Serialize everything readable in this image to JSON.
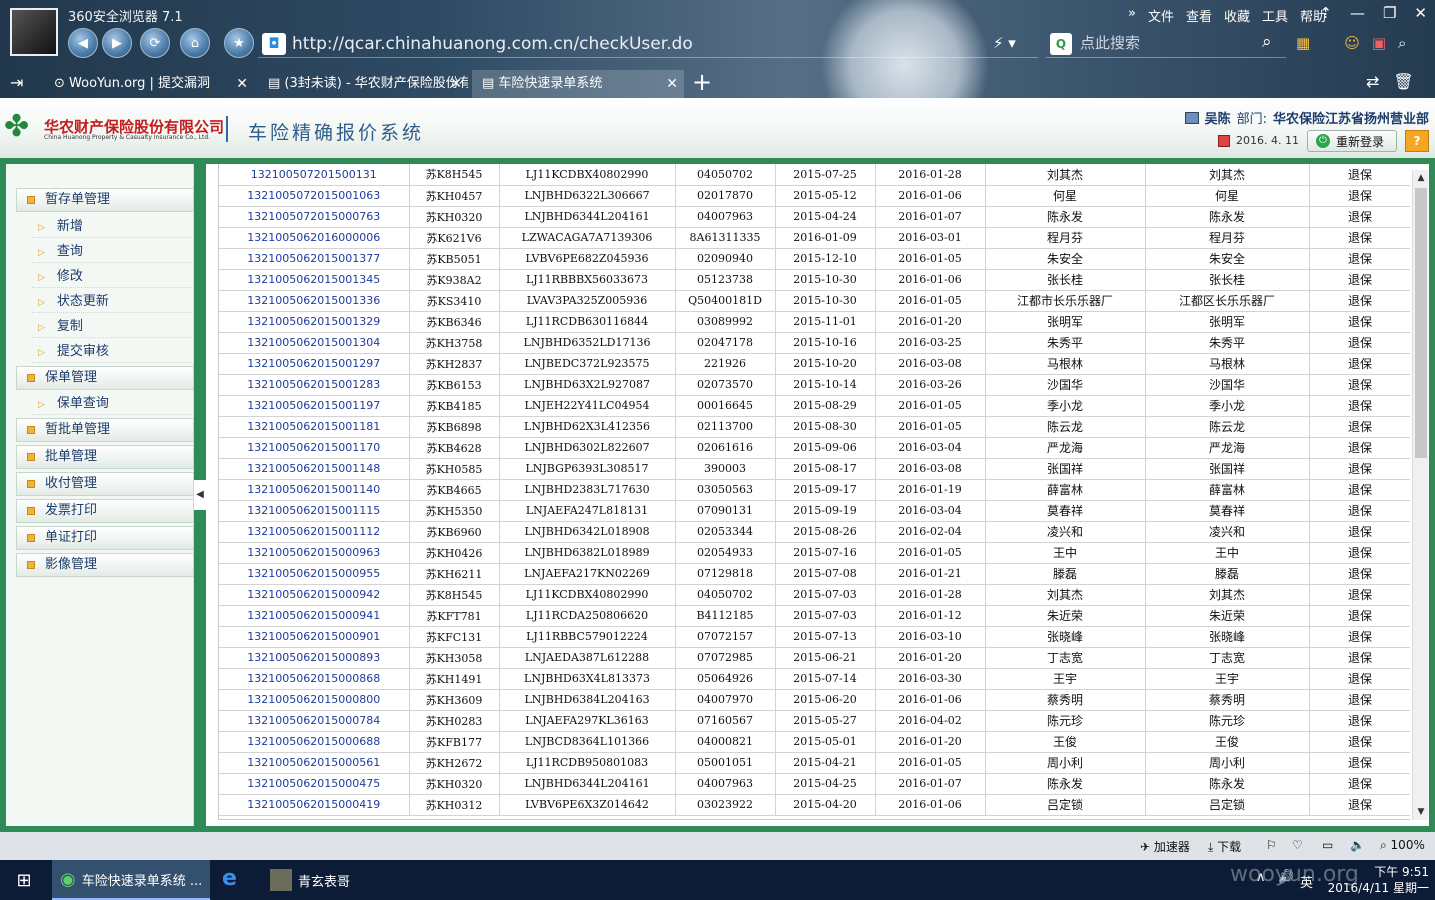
{
  "browser": {
    "title": "360安全浏览器 7.1",
    "url": "http://qcar.chinahuanong.com.cn/checkUser.do",
    "search_placeholder": "点此搜索",
    "menus": [
      "文件",
      "查看",
      "收藏",
      "工具",
      "帮助"
    ],
    "more": "»",
    "tabs": [
      {
        "label": "WooYun.org | 提交漏洞"
      },
      {
        "label": "(3封未读) - 华农财产保险股份有"
      },
      {
        "label": "车险快速录单系统"
      }
    ],
    "new_tab": "+"
  },
  "header": {
    "company_name": "华农财产保险股份有限公司",
    "company_en": "China Huanong Property & Casualty Insurance Co., Ltd.",
    "system_title": "车险精确报价系统",
    "user_name": "吴陈",
    "dept_label": "部门:",
    "dept_value": "华农保险江苏省扬州营业部",
    "date": "2016. 4. 11",
    "relogin": "重新登录",
    "help": "?"
  },
  "sidebar": {
    "groups": [
      {
        "label": "暂存单管理",
        "items": [
          "新增",
          "查询",
          "修改",
          "状态更新",
          "复制",
          "提交审核"
        ]
      },
      {
        "label": "保单管理",
        "items": [
          "保单查询"
        ]
      },
      {
        "label": "暂批单管理",
        "items": []
      },
      {
        "label": "批单管理",
        "items": []
      },
      {
        "label": "收付管理",
        "items": []
      },
      {
        "label": "发票打印",
        "items": []
      },
      {
        "label": "单证打印",
        "items": []
      },
      {
        "label": "影像管理",
        "items": []
      }
    ]
  },
  "table": {
    "rows": [
      [
        "132100507201500131",
        "苏K8H545",
        "LJ11KCDBX40802990",
        "04050702",
        "2015-07-25",
        "2016-01-28",
        "刘其杰",
        "刘其杰",
        "退保"
      ],
      [
        "1321005072015001063",
        "苏KH0457",
        "LNJBHD6322L306667",
        "02017870",
        "2015-05-12",
        "2016-01-06",
        "何星",
        "何星",
        "退保"
      ],
      [
        "1321005072015000763",
        "苏KH0320",
        "LNJBHD6344L204161",
        "04007963",
        "2015-04-24",
        "2016-01-07",
        "陈永发",
        "陈永发",
        "退保"
      ],
      [
        "1321005062016000006",
        "苏K621V6",
        "LZWACAGA7A7139306",
        "8A61311335",
        "2016-01-09",
        "2016-03-01",
        "程月芬",
        "程月芬",
        "退保"
      ],
      [
        "1321005062015001377",
        "苏KB5051",
        "LVBV6PE682Z045936",
        "02090940",
        "2015-12-10",
        "2016-01-05",
        "朱安全",
        "朱安全",
        "退保"
      ],
      [
        "1321005062015001345",
        "苏K938A2",
        "LJ11RBBBX56033673",
        "05123738",
        "2015-10-30",
        "2016-01-06",
        "张长桂",
        "张长桂",
        "退保"
      ],
      [
        "1321005062015001336",
        "苏KS3410",
        "LVAV3PA325Z005936",
        "Q50400181D",
        "2015-10-30",
        "2016-01-05",
        "江都市长乐乐器厂",
        "江都区长乐乐器厂",
        "退保"
      ],
      [
        "1321005062015001329",
        "苏KB6346",
        "LJ11RCDB630116844",
        "03089992",
        "2015-11-01",
        "2016-01-20",
        "张明军",
        "张明军",
        "退保"
      ],
      [
        "1321005062015001304",
        "苏KH3758",
        "LNJBHD6352LD17136",
        "02047178",
        "2015-10-16",
        "2016-03-25",
        "朱秀平",
        "朱秀平",
        "退保"
      ],
      [
        "1321005062015001297",
        "苏KH2837",
        "LNJBEDC372L923575",
        "221926",
        "2015-10-20",
        "2016-03-08",
        "马根林",
        "马根林",
        "退保"
      ],
      [
        "1321005062015001283",
        "苏KB6153",
        "LNJBHD63X2L927087",
        "02073570",
        "2015-10-14",
        "2016-03-26",
        "沙国华",
        "沙国华",
        "退保"
      ],
      [
        "1321005062015001197",
        "苏KB4185",
        "LNJEH22Y41LC04954",
        "00016645",
        "2015-08-29",
        "2016-01-05",
        "季小龙",
        "季小龙",
        "退保"
      ],
      [
        "1321005062015001181",
        "苏KB6898",
        "LNJBHD62X3L412356",
        "02113700",
        "2015-08-30",
        "2016-01-05",
        "陈云龙",
        "陈云龙",
        "退保"
      ],
      [
        "1321005062015001170",
        "苏KB4628",
        "LNJBHD6302L822607",
        "02061616",
        "2015-09-06",
        "2016-03-04",
        "严龙海",
        "严龙海",
        "退保"
      ],
      [
        "1321005062015001148",
        "苏KH0585",
        "LNJBGP6393L308517",
        "390003",
        "2015-08-17",
        "2016-03-08",
        "张国祥",
        "张国祥",
        "退保"
      ],
      [
        "1321005062015001140",
        "苏KB4665",
        "LNJBHD2383L717630",
        "03050563",
        "2015-09-17",
        "2016-01-19",
        "薛富林",
        "薛富林",
        "退保"
      ],
      [
        "1321005062015001115",
        "苏KH5350",
        "LNJAEFA247L818131",
        "07090131",
        "2015-09-19",
        "2016-03-04",
        "莫春祥",
        "莫春祥",
        "退保"
      ],
      [
        "1321005062015001112",
        "苏KB6960",
        "LNJBHD6342L018908",
        "02053344",
        "2015-08-26",
        "2016-02-04",
        "凌兴和",
        "凌兴和",
        "退保"
      ],
      [
        "1321005062015000963",
        "苏KH0426",
        "LNJBHD6382L018989",
        "02054933",
        "2015-07-16",
        "2016-01-05",
        "王中",
        "王中",
        "退保"
      ],
      [
        "1321005062015000955",
        "苏KH6211",
        "LNJAEFA217KN02269",
        "07129818",
        "2015-07-08",
        "2016-01-21",
        "滕磊",
        "滕磊",
        "退保"
      ],
      [
        "1321005062015000942",
        "苏K8H545",
        "LJ11KCDBX40802990",
        "04050702",
        "2015-07-03",
        "2016-01-28",
        "刘其杰",
        "刘其杰",
        "退保"
      ],
      [
        "1321005062015000941",
        "苏KFT781",
        "LJ11RCDA250806620",
        "B4112185",
        "2015-07-03",
        "2016-01-12",
        "朱近荣",
        "朱近荣",
        "退保"
      ],
      [
        "1321005062015000901",
        "苏KFC131",
        "LJ11RBBC579012224",
        "07072157",
        "2015-07-13",
        "2016-03-10",
        "张晓峰",
        "张晓峰",
        "退保"
      ],
      [
        "1321005062015000893",
        "苏KH3058",
        "LNJAEDA387L612288",
        "07072985",
        "2015-06-21",
        "2016-01-20",
        "丁志宽",
        "丁志宽",
        "退保"
      ],
      [
        "1321005062015000868",
        "苏KH1491",
        "LNJBHD63X4L813373",
        "05064926",
        "2015-07-14",
        "2016-03-30",
        "王宇",
        "王宇",
        "退保"
      ],
      [
        "1321005062015000800",
        "苏KH3609",
        "LNJBHD6384L204163",
        "04007970",
        "2015-06-20",
        "2016-01-06",
        "蔡秀明",
        "蔡秀明",
        "退保"
      ],
      [
        "1321005062015000784",
        "苏KH0283",
        "LNJAEFA297KL36163",
        "07160567",
        "2015-05-27",
        "2016-04-02",
        "陈元珍",
        "陈元珍",
        "退保"
      ],
      [
        "1321005062015000688",
        "苏KFB177",
        "LNJBCD8364L101366",
        "04000821",
        "2015-05-01",
        "2016-01-20",
        "王俊",
        "王俊",
        "退保"
      ],
      [
        "1321005062015000561",
        "苏KH2672",
        "LJ11RCDB950801083",
        "05001051",
        "2015-04-21",
        "2016-01-05",
        "周小利",
        "周小利",
        "退保"
      ],
      [
        "1321005062015000475",
        "苏KH0320",
        "LNJBHD6344L204161",
        "04007963",
        "2015-04-25",
        "2016-01-07",
        "陈永发",
        "陈永发",
        "退保"
      ],
      [
        "1321005062015000419",
        "苏KH0312",
        "LVBV6PE6X3Z014642",
        "03023922",
        "2015-04-20",
        "2016-01-06",
        "吕定锁",
        "吕定锁",
        "退保"
      ]
    ]
  },
  "statusbar": {
    "accelerator": "加速器",
    "download": "下载",
    "zoom": "100%"
  },
  "taskbar": {
    "task1": "车险快速录单系统 ...",
    "task2": "青玄表哥",
    "lang": "英",
    "time": "下午 9:51",
    "date": "2016/4/11 星期一"
  },
  "watermark": "wooyun.org"
}
